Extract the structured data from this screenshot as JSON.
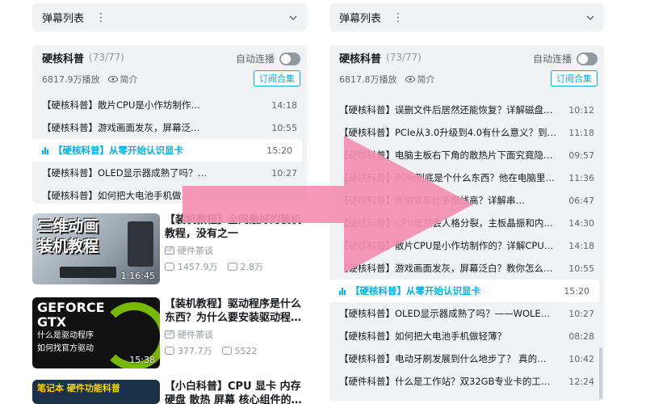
{
  "left_panel": {
    "danmaku": {
      "label": "弹幕列表",
      "more": "⋮"
    },
    "playlist": {
      "title": "硬核科普",
      "count": "(73/77)",
      "autoplay": "自动连播",
      "views": "6817.9万播放",
      "intro": "简介",
      "subscribe": "订阅合集",
      "items": [
        {
          "title": "【硬核科普】散片CPU是小作坊制作…",
          "duration": "14:18"
        },
        {
          "title": "【硬核科普】游戏画面发灰，屏幕泛…",
          "duration": "10:55"
        },
        {
          "title": "【硬核科普】从零开始认识显卡",
          "duration": "15:20",
          "active": true
        },
        {
          "title": "【硬核科普】OLED显示器成熟了吗？…",
          "duration": "10:27"
        },
        {
          "title": "【硬核科普】如何把大电池手机做…",
          "duration": ""
        }
      ]
    },
    "recommendations": [
      {
        "title": "【装机教程】全网最好的装机教程，没有之一",
        "uploader": "硬件茶谈",
        "views": "1457.9万",
        "danmaku": "2.8万",
        "duration": "1:16:45",
        "thumb_text": "三维动画\n装机教程"
      },
      {
        "title": "【装机教程】驱动程序是什么东西？为什么要安装驱动程…",
        "uploader": "硬件茶谈",
        "views": "377.7万",
        "danmaku": "5522",
        "duration": "15:38",
        "thumb_text_1": "GEFORCE\nGTX",
        "thumb_text_2": "什么是驱动程序\n如何找官方驱动"
      },
      {
        "title": "【小白科普】CPU 显卡 内存 硬盘 散热 屏幕 核心组件的…",
        "thumb_text": "笔记本 硬件功能科普"
      }
    ]
  },
  "right_panel": {
    "danmaku": {
      "label": "弹幕列表",
      "more": "⋮"
    },
    "playlist": {
      "title": "硬核科普",
      "count": "(73/77)",
      "autoplay": "自动连播",
      "views": "6817.8万播放",
      "intro": "简介",
      "subscribe": "订阅合集",
      "items": [
        {
          "title": "【硬核科普】误删文件后居然还能恢复？详解磁盘…",
          "duration": "10:12"
        },
        {
          "title": "【硬核科普】PCIe从3.0升级到4.0有什么意义？到…",
          "duration": "11:18"
        },
        {
          "title": "【硬核科普】电脑主板右下角的散热片下面究竟隐…",
          "duration": "09:57"
        },
        {
          "title": "【硬核科普】PCIe到底是个什么东西？他在电脑里…",
          "duration": "11:36"
        },
        {
          "title": "【硬核科普】传输效率比多根线高？详解串…",
          "duration": "06:47"
        },
        {
          "title": "【硬核科普】CPU居然会人格分裂，主板晶振和内…",
          "duration": "14:30"
        },
        {
          "title": "【硬核科普】散片CPU是小作坊制作的？详解CPU…",
          "duration": "14:18"
        },
        {
          "title": "【硬核科普】游戏画面发灰，屏幕泛白？教你怎么…",
          "duration": "10:55"
        },
        {
          "title": "【硬核科普】从零开始认识显卡",
          "duration": "15:20",
          "active": true
        },
        {
          "title": "【硬核科普】OLED显示器成熟了吗？——WOLE…",
          "duration": "10:27"
        },
        {
          "title": "【硬核科普】如何把大电池手机做轻薄？",
          "duration": "08:28"
        },
        {
          "title": "【硬核科普】电动牙刷发展到什么地步了？ 真的…",
          "duration": "10:42"
        },
        {
          "title": "【硬件科普】什么是工作站？双32GB专业卡的工…",
          "duration": "12:24"
        }
      ]
    }
  },
  "colors": {
    "accent": "#00aeec",
    "arrow": "#f48fb1",
    "panel_bg": "#f1f2f3"
  }
}
